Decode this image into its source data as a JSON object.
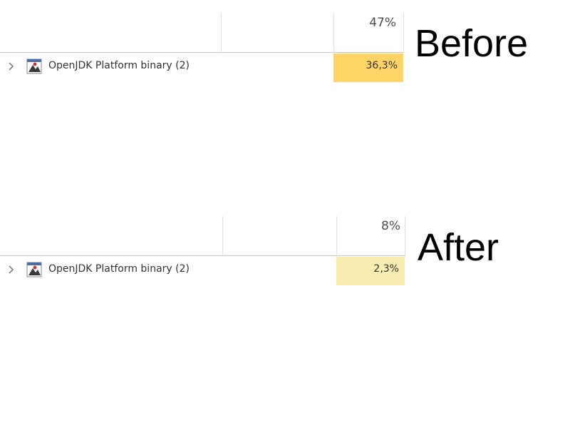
{
  "before": {
    "label": "Before",
    "cpu_header": "47%",
    "process": {
      "name": "OpenJDK Platform binary (2)",
      "cpu": "36,3%",
      "highlight_color": "#ffd466"
    }
  },
  "after": {
    "label": "After",
    "cpu_header": "8%",
    "process": {
      "name": "OpenJDK Platform binary (2)",
      "cpu": "2,3%",
      "highlight_color": "#f9eeb2"
    }
  },
  "icons": {
    "expand": "chevron-right-icon",
    "process": "java-app-icon"
  }
}
